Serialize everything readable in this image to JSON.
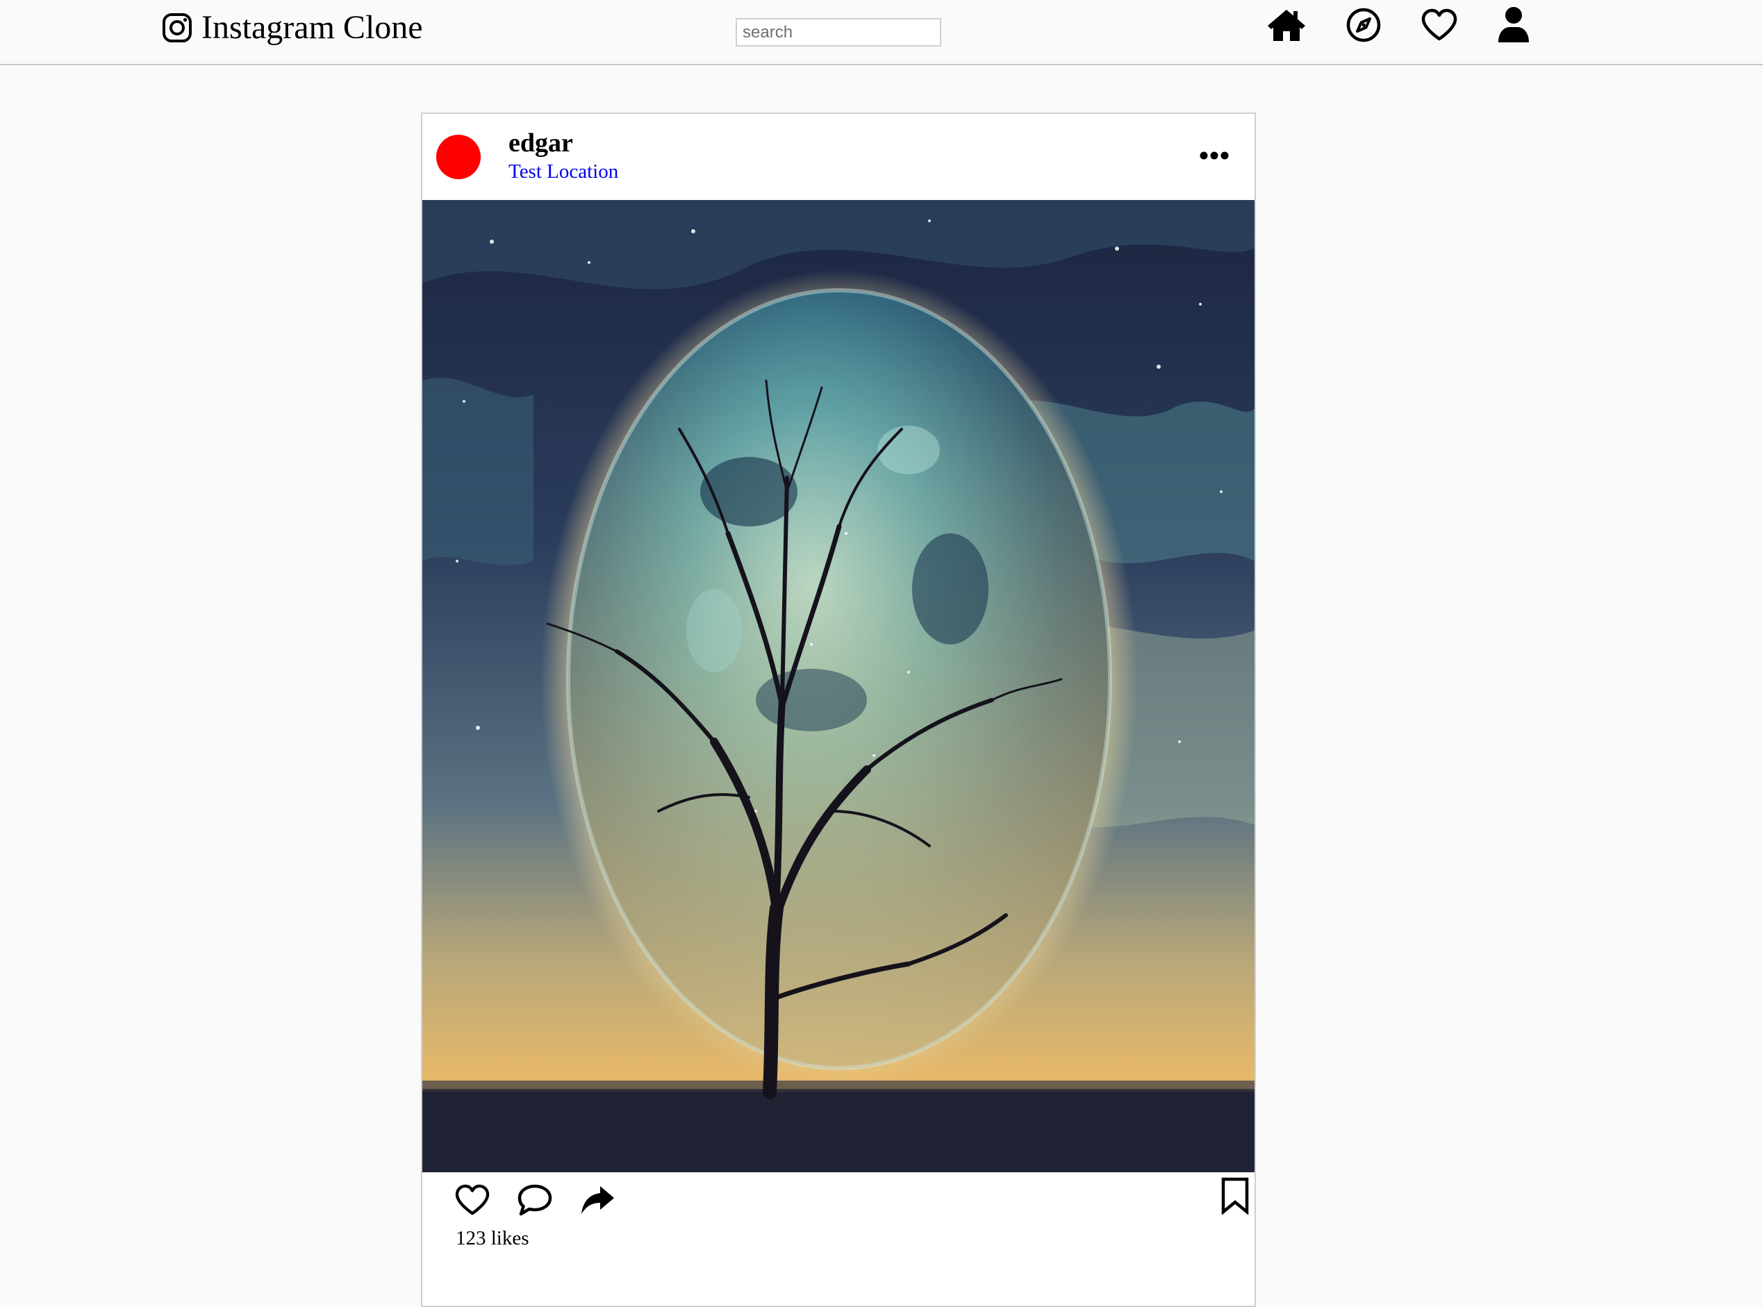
{
  "app": {
    "title": "Instagram Clone",
    "logo_icon": "instagram-glyph-icon"
  },
  "search": {
    "placeholder": "search",
    "value": ""
  },
  "nav": {
    "icons": [
      "home-icon",
      "compass-icon",
      "heart-icon",
      "user-icon"
    ]
  },
  "post": {
    "username": "edgar",
    "location": "Test Location",
    "avatar_color": "#ff0000",
    "likes_count": "123",
    "likes_suffix": "likes",
    "image_subject": "painted tree in front of a giant glowing moon under a starry sky",
    "icons": {
      "more": "more-options-icon",
      "like": "heart-outline-icon",
      "comment": "comment-bubble-icon",
      "share": "share-arrow-icon",
      "save": "bookmark-icon"
    }
  },
  "colors": {
    "page_background": "#fafafa",
    "card_background": "#ffffff",
    "border": "#cfcfcf",
    "link": "#0000ee"
  }
}
